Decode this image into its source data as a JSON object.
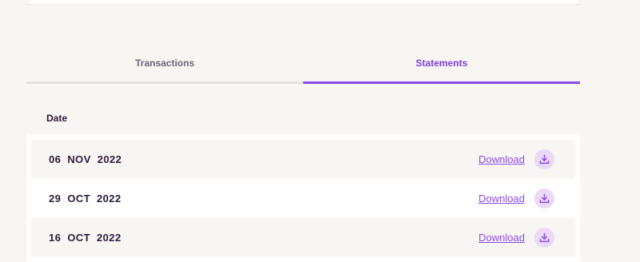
{
  "tabs": [
    {
      "label": "Transactions",
      "active": false
    },
    {
      "label": "Statements",
      "active": true
    }
  ],
  "table": {
    "date_header": "Date",
    "rows": [
      {
        "date": "06 NOV 2022",
        "action_label": "Download",
        "icon": "download-icon"
      },
      {
        "date": "29 OCT 2022",
        "action_label": "Download",
        "icon": "download-icon"
      },
      {
        "date": "16 OCT 2022",
        "action_label": "Download",
        "icon": "download-icon"
      }
    ]
  },
  "colors": {
    "accent": "#8a4ce8",
    "background": "#f9f5f2",
    "text": "#2c1a3d",
    "icon_bg": "#ead9f7"
  }
}
